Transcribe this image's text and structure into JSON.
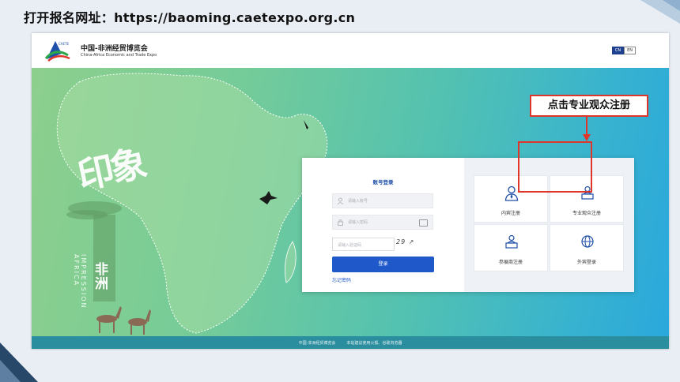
{
  "slide": {
    "title": "打开报名网址：https://baoming.caetexpo.org.cn"
  },
  "site": {
    "logo_badge": "CAETE",
    "logo_cn": "中国-非洲经贸博览会",
    "logo_en": "China-Africa Economic and Trade Expo",
    "lang_cn": "CN",
    "lang_en": "EN"
  },
  "hero": {
    "title_art": "印象",
    "subtitle_cn": "非洲",
    "subtitle_en": "IMPRESSION AFRICA"
  },
  "login": {
    "title": "账号登录",
    "account_placeholder": "请输入账号",
    "password_placeholder": "请输入密码",
    "captcha_placeholder": "请输入验证码",
    "captcha_text": "29 ↗ ",
    "login_button": "登录",
    "forgot": "忘记密码"
  },
  "register": {
    "tiles": [
      {
        "label": "内宾注册",
        "icon": "person-tie-icon"
      },
      {
        "label": "专业观众注册",
        "icon": "person-desk-icon"
      },
      {
        "label": "参展商注册",
        "icon": "person-desk-icon"
      },
      {
        "label": "外宾登录",
        "icon": "globe-icon"
      }
    ]
  },
  "footer": {
    "org": "中国-非洲经贸博览会",
    "tip": "本站建议使用火狐、谷歌浏览器"
  },
  "annotation": {
    "callout": "点击专业观众注册"
  },
  "colors": {
    "brand_blue": "#1f59c9",
    "highlight_red": "#e0352b"
  }
}
